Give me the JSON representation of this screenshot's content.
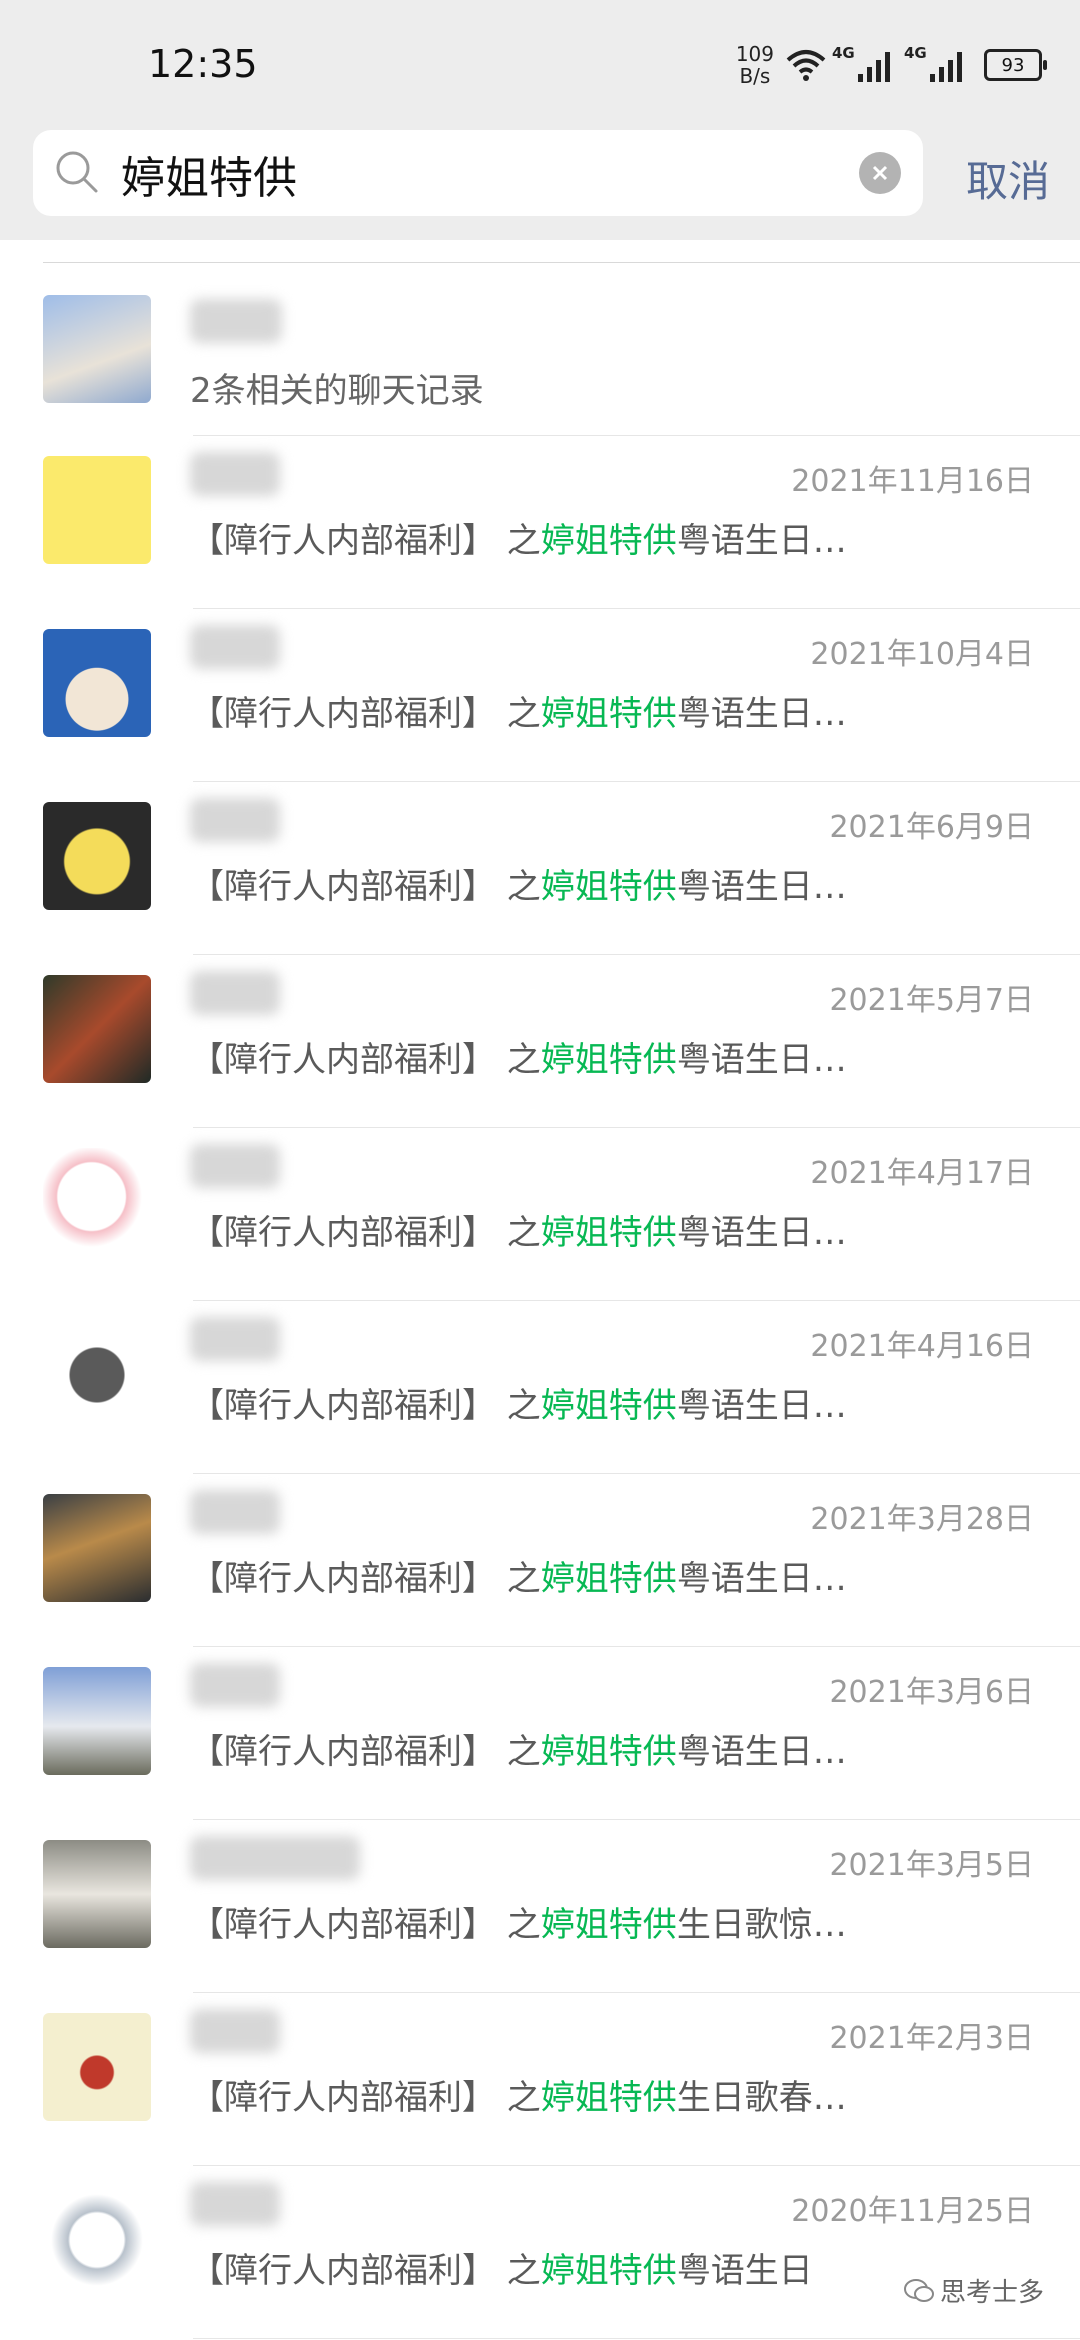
{
  "status": {
    "time": "12:35",
    "net_speed": "109",
    "net_unit": "B/s",
    "sim1": "4G",
    "sim2": "4G",
    "battery": "93"
  },
  "search": {
    "query": "婷姐特供",
    "cancel_label": "取消"
  },
  "first_result": {
    "summary": "2条相关的聊天记录"
  },
  "results": [
    {
      "date": "2021年11月16日",
      "prefix": "【障行人内部福利】 之",
      "keyword": "婷姐特供",
      "suffix": "粤语生日…"
    },
    {
      "date": "2021年10月4日",
      "prefix": "【障行人内部福利】 之",
      "keyword": "婷姐特供",
      "suffix": "粤语生日…"
    },
    {
      "date": "2021年6月9日",
      "prefix": "【障行人内部福利】 之",
      "keyword": "婷姐特供",
      "suffix": "粤语生日…"
    },
    {
      "date": "2021年5月7日",
      "prefix": "【障行人内部福利】 之",
      "keyword": "婷姐特供",
      "suffix": "粤语生日…"
    },
    {
      "date": "2021年4月17日",
      "prefix": "【障行人内部福利】 之",
      "keyword": "婷姐特供",
      "suffix": "粤语生日…"
    },
    {
      "date": "2021年4月16日",
      "prefix": "【障行人内部福利】 之",
      "keyword": "婷姐特供",
      "suffix": "粤语生日…"
    },
    {
      "date": "2021年3月28日",
      "prefix": "【障行人内部福利】 之",
      "keyword": "婷姐特供",
      "suffix": "粤语生日…"
    },
    {
      "date": "2021年3月6日",
      "prefix": "【障行人内部福利】 之",
      "keyword": "婷姐特供",
      "suffix": "粤语生日…"
    },
    {
      "date": "2021年3月5日",
      "prefix": "【障行人内部福利】 之",
      "keyword": "婷姐特供",
      "suffix": "生日歌惊…"
    },
    {
      "date": "2021年2月3日",
      "prefix": "【障行人内部福利】 之",
      "keyword": "婷姐特供",
      "suffix": "生日歌春…"
    },
    {
      "date": "2020年11月25日",
      "prefix": "【障行人内部福利】 之",
      "keyword": "婷姐特供",
      "suffix": "粤语生日"
    }
  ],
  "watermark": "思考士多",
  "colors": {
    "highlight": "#07b853",
    "cancel": "#576b95",
    "header_bg": "#ededed"
  }
}
